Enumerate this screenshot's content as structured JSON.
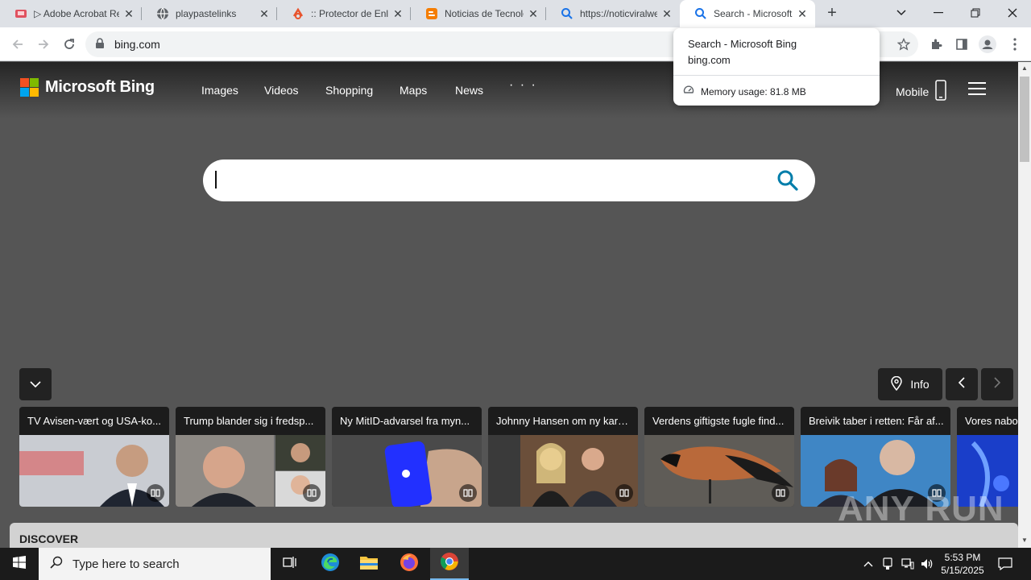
{
  "browser": {
    "tabs": [
      {
        "title": "Adobe Acrobat Reader",
        "prefix": "▷ ",
        "favicon": "acrobat-icon",
        "active": false
      },
      {
        "title": "playpastelinks",
        "prefix": "",
        "favicon": "globe-icon",
        "active": false
      },
      {
        "title": ":: Protector de Enlaces",
        "prefix": "",
        "favicon": "link-icon",
        "active": false
      },
      {
        "title": "Noticias de Tecnología",
        "prefix": "",
        "favicon": "blogger-icon",
        "active": false
      },
      {
        "title": "https://noticviralweb",
        "prefix": "",
        "favicon": "bing-search-icon",
        "active": false
      },
      {
        "title": "Search - Microsoft Bing",
        "prefix": "",
        "favicon": "bing-search-icon",
        "active": true
      }
    ],
    "url": "bing.com",
    "hover_card": {
      "title": "Search - Microsoft Bing",
      "domain": "bing.com",
      "memory": "Memory usage: 81.8 MB"
    }
  },
  "bing": {
    "logo_text": "Microsoft Bing",
    "nav": [
      "Images",
      "Videos",
      "Shopping",
      "Maps",
      "News"
    ],
    "more": "· · ·",
    "mobile_label": "Mobile",
    "search_value": "",
    "info_label": "Info",
    "cards": [
      {
        "title": "TV Avisen-vært og USA-ko..."
      },
      {
        "title": "Trump blander sig i fredsp..."
      },
      {
        "title": "Ny MitID-advarsel fra myn..."
      },
      {
        "title": "Johnny Hansen om ny karri..."
      },
      {
        "title": "Verdens giftigste fugle find..."
      },
      {
        "title": "Breivik taber i retten: Får af..."
      },
      {
        "title": "Vores nabo"
      }
    ],
    "discover_label": "DISCOVER"
  },
  "watermark": "ANY RUN",
  "taskbar": {
    "search_placeholder": "Type here to search",
    "time": "5:53 PM",
    "date": "5/15/2025"
  },
  "colors": {
    "bing_teal": "#007daa",
    "page_bg": "#555555",
    "tab_strip": "#dee1e6"
  }
}
